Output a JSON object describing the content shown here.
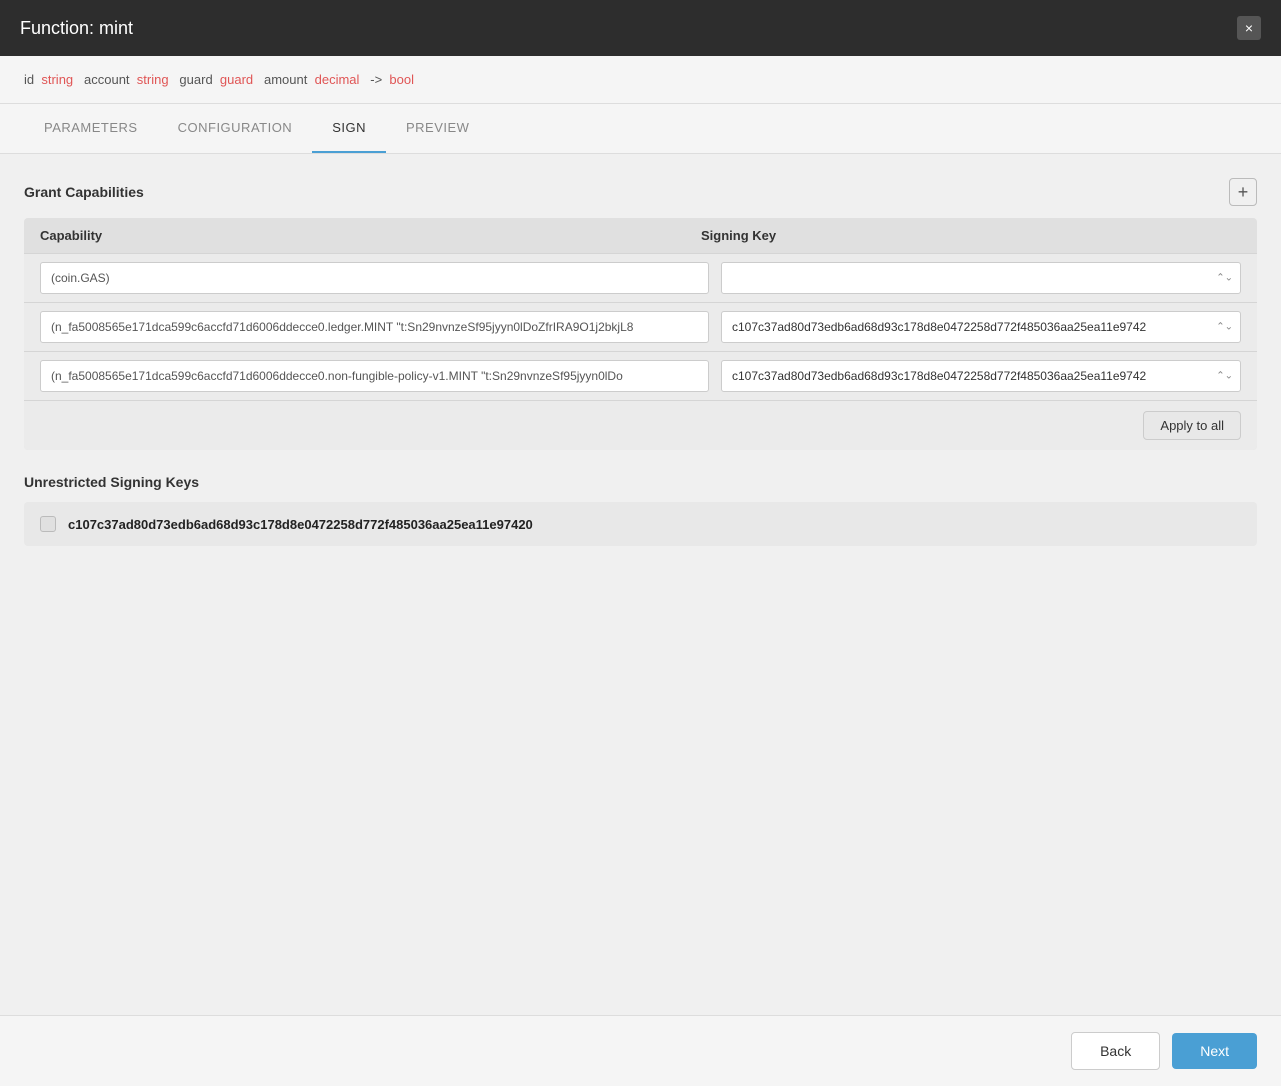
{
  "header": {
    "title": "Function: mint",
    "close_label": "×"
  },
  "signature": {
    "id_label": "id",
    "id_type": "string",
    "account_label": "account",
    "account_type": "string",
    "guard_label": "guard",
    "guard_type": "guard",
    "amount_label": "amount",
    "amount_type": "decimal",
    "arrow": "->",
    "return_type": "bool"
  },
  "tabs": [
    {
      "label": "PARAMETERS",
      "active": false
    },
    {
      "label": "CONFIGURATION",
      "active": false
    },
    {
      "label": "SIGN",
      "active": true
    },
    {
      "label": "PREVIEW",
      "active": false
    }
  ],
  "grant_capabilities": {
    "title": "Grant Capabilities",
    "add_icon": "+",
    "capability_col": "Capability",
    "signing_key_col": "Signing Key",
    "rows": [
      {
        "capability": "(coin.GAS)",
        "signing_key": ""
      },
      {
        "capability": "(n_fa5008565e171dca599c6accfd71d6006ddecce0.ledger.MINT \"t:Sn29nvnzeSf95jyyn0lDoZfrIRA9O1j2bkjL8",
        "signing_key": "c107c37ad80d73edb6ad68d93c178d8e0472258d772f485036aa25ea11e9742"
      },
      {
        "capability": "(n_fa5008565e171dca599c6accfd71d6006ddecce0.non-fungible-policy-v1.MINT \"t:Sn29nvnzeSf95jyyn0lDo",
        "signing_key": "c107c37ad80d73edb6ad68d93c178d8e0472258d772f485036aa25ea11e9742"
      }
    ],
    "apply_to_all_label": "Apply to all"
  },
  "unrestricted_signing_keys": {
    "title": "Unrestricted Signing Keys",
    "keys": [
      {
        "key": "c107c37ad80d73edb6ad68d93c178d8e0472258d772f485036aa25ea11e97420",
        "checked": false
      }
    ]
  },
  "footer": {
    "back_label": "Back",
    "next_label": "Next"
  }
}
